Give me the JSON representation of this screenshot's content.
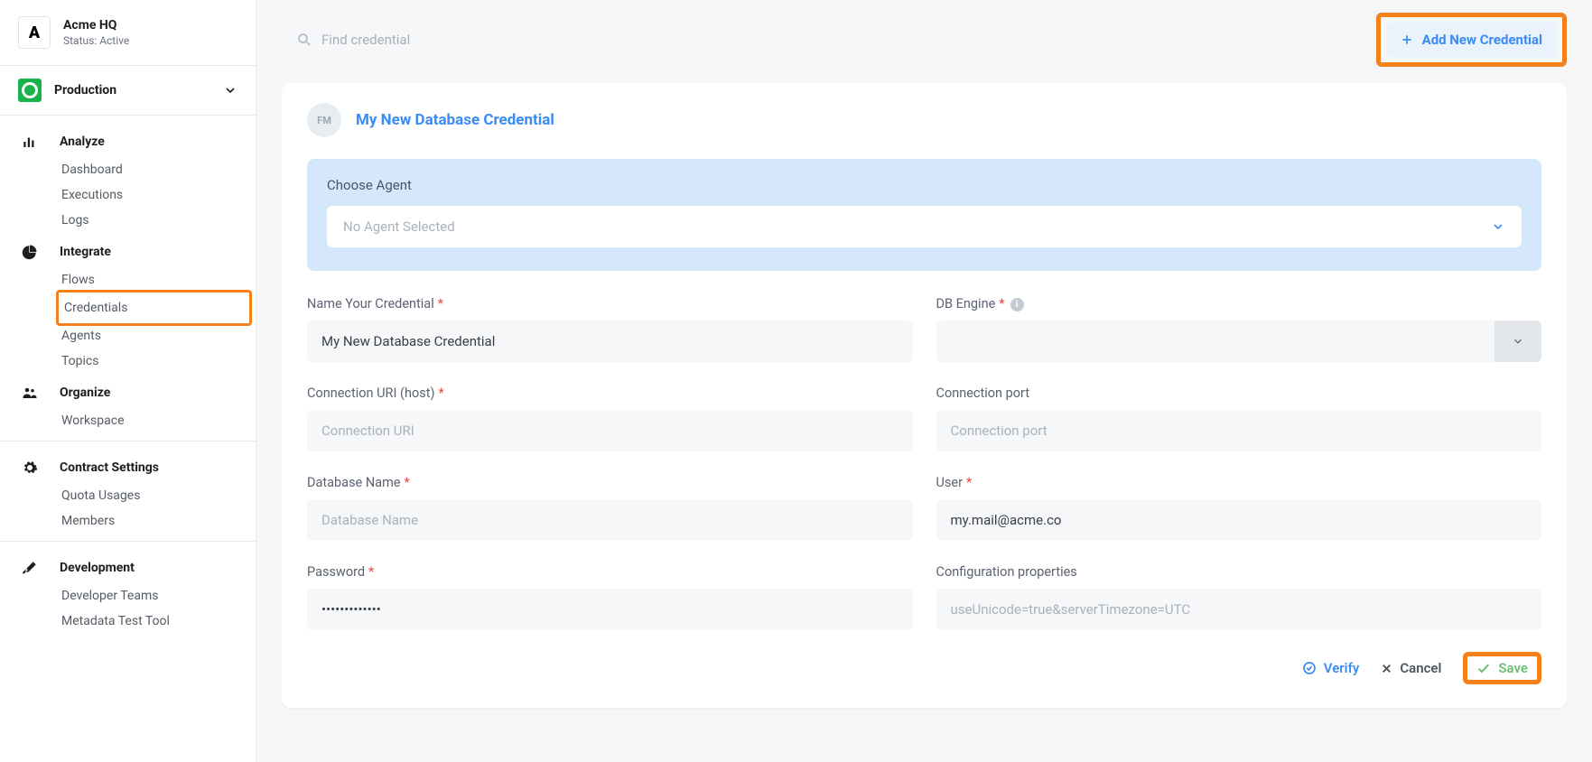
{
  "org": {
    "logo_letter": "A",
    "name": "Acme HQ",
    "status": "Status: Active"
  },
  "env": {
    "name": "Production"
  },
  "nav": {
    "analyze": {
      "title": "Analyze",
      "items": [
        "Dashboard",
        "Executions",
        "Logs"
      ]
    },
    "integrate": {
      "title": "Integrate",
      "items": [
        "Flows",
        "Credentials",
        "Agents",
        "Topics"
      ]
    },
    "organize": {
      "title": "Organize",
      "items": [
        "Workspace"
      ]
    },
    "contract": {
      "title": "Contract Settings",
      "items": [
        "Quota Usages",
        "Members"
      ]
    },
    "dev": {
      "title": "Development",
      "items": [
        "Developer Teams",
        "Metadata Test Tool"
      ]
    }
  },
  "topbar": {
    "search_placeholder": "Find credential",
    "add_btn": "Add New Credential"
  },
  "panel": {
    "avatar_initials": "FM",
    "title": "My New Database Credential",
    "agent": {
      "label": "Choose Agent",
      "placeholder": "No Agent Selected"
    },
    "fields": {
      "name": {
        "label": "Name Your Credential",
        "value": "My New Database Credential"
      },
      "engine": {
        "label": "DB Engine"
      },
      "uri": {
        "label": "Connection URI (host)",
        "placeholder": "Connection URI"
      },
      "port": {
        "label": "Connection port",
        "placeholder": "Connection port"
      },
      "dbname": {
        "label": "Database Name",
        "placeholder": "Database Name"
      },
      "user": {
        "label": "User",
        "value": "my.mail@acme.co"
      },
      "password": {
        "label": "Password",
        "value": "•••••••••••••"
      },
      "config": {
        "label": "Configuration properties",
        "placeholder": "useUnicode=true&serverTimezone=UTC"
      }
    },
    "actions": {
      "verify": "Verify",
      "cancel": "Cancel",
      "save": "Save"
    }
  }
}
